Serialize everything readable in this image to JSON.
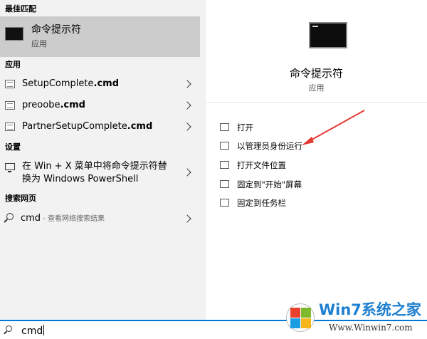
{
  "sections": {
    "best_match": "最佳匹配",
    "apps": "应用",
    "settings": "设置",
    "web": "搜索网页"
  },
  "best_match": {
    "title": "命令提示符",
    "subtitle": "应用",
    "icon": "cmd-terminal-icon"
  },
  "apps": [
    {
      "name_plain": "SetupComplete",
      "name_bold": ".cmd",
      "icon": "cmd-file-icon"
    },
    {
      "name_plain": "preoobe",
      "name_bold": ".cmd",
      "icon": "cmd-file-icon"
    },
    {
      "name_plain": "PartnerSetupComplete",
      "name_bold": ".cmd",
      "icon": "cmd-file-icon"
    }
  ],
  "setting": {
    "line1": "在 Win + X 菜单中将命令提示符替",
    "line2": "换为 Windows PowerShell",
    "icon": "monitor-icon"
  },
  "web_search": {
    "query": "cmd",
    "suffix": " - 查看网络搜索结果",
    "icon": "search-icon"
  },
  "preview": {
    "title": "命令提示符",
    "subtitle": "应用",
    "icon": "cmd-terminal-icon"
  },
  "actions": [
    {
      "label": "打开",
      "icon": "open-icon"
    },
    {
      "label": "以管理员身份运行",
      "icon": "run-as-admin-icon"
    },
    {
      "label": "打开文件位置",
      "icon": "file-location-icon"
    },
    {
      "label": "固定到\"开始\"屏幕",
      "icon": "pin-icon"
    },
    {
      "label": "固定到任务栏",
      "icon": "pin-taskbar-icon"
    }
  ],
  "search_box": {
    "value": "cmd"
  },
  "watermark": {
    "brand": "Win7系统之家",
    "site": "Www.Winwin7.com"
  },
  "colors": {
    "highlight": "#cccccc",
    "accent": "#0078d7",
    "arrow": "#e53935"
  }
}
